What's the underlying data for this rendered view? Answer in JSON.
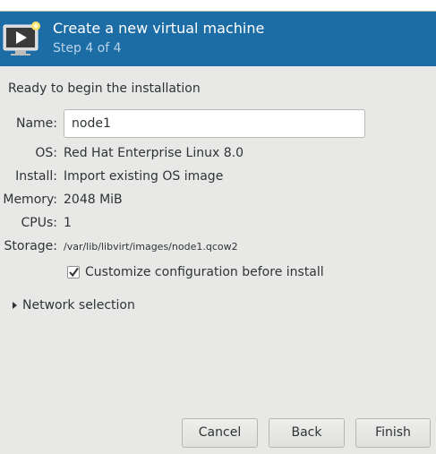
{
  "header": {
    "title": "Create a new virtual machine",
    "step": "Step 4 of 4",
    "icon": "virtual-machine-wizard-icon"
  },
  "intro": "Ready to begin the installation",
  "fields": {
    "name": {
      "label": "Name:",
      "value": "node1"
    },
    "os": {
      "label": "OS:",
      "value": "Red Hat Enterprise Linux 8.0"
    },
    "install": {
      "label": "Install:",
      "value": "Import existing OS image"
    },
    "memory": {
      "label": "Memory:",
      "value": "2048 MiB"
    },
    "cpus": {
      "label": "CPUs:",
      "value": "1"
    },
    "storage": {
      "label": "Storage:",
      "value": "/var/lib/libvirt/images/node1.qcow2"
    }
  },
  "customize": {
    "label": "Customize configuration before install",
    "checked": true
  },
  "network": {
    "label": "Network selection",
    "expanded": false
  },
  "buttons": {
    "cancel": "Cancel",
    "back": "Back",
    "finish": "Finish"
  },
  "colors": {
    "header_bg": "#1c6ca5",
    "header_step": "#b9d3eb",
    "window_bg": "#e8e8e7"
  }
}
